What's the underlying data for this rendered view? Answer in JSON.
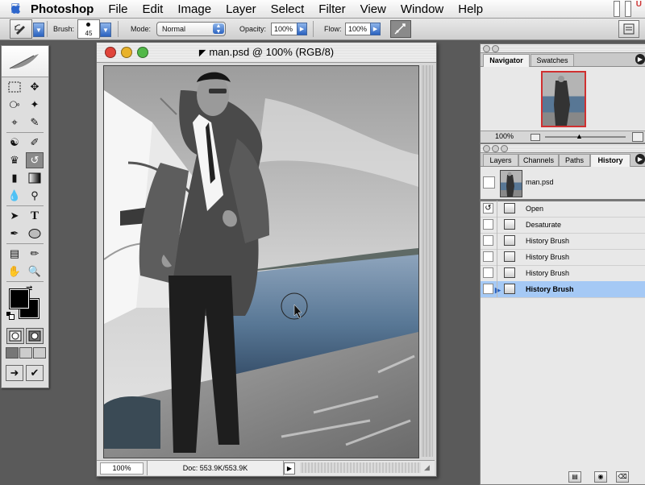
{
  "menubar": {
    "app_name": "Photoshop",
    "items": [
      "File",
      "Edit",
      "Image",
      "Layer",
      "Select",
      "Filter",
      "View",
      "Window",
      "Help"
    ],
    "apple_icon": "apple-logo",
    "status_letter": "U"
  },
  "options_bar": {
    "brush_label": "Brush:",
    "brush_size": "45",
    "mode_label": "Mode:",
    "mode_value": "Normal",
    "opacity_label": "Opacity:",
    "opacity_value": "100%",
    "flow_label": "Flow:",
    "flow_value": "100%"
  },
  "document": {
    "title": "man.psd @ 100% (RGB/8)",
    "zoom": "100%",
    "doc_size": "Doc: 553.9K/553.9K"
  },
  "navigator_panel": {
    "tabs": [
      "Navigator",
      "Swatches"
    ],
    "active_tab": "Navigator",
    "zoom": "100%"
  },
  "layers_panel": {
    "tabs": [
      "Layers",
      "Channels",
      "Paths",
      "History"
    ],
    "active_tab": "History",
    "snapshot_label": "man.psd",
    "history_states": [
      {
        "label": "Open",
        "selected": false
      },
      {
        "label": "Desaturate",
        "selected": false
      },
      {
        "label": "History Brush",
        "selected": false
      },
      {
        "label": "History Brush",
        "selected": false
      },
      {
        "label": "History Brush",
        "selected": false
      },
      {
        "label": "History Brush",
        "selected": true
      }
    ]
  },
  "colors": {
    "selection_blue": "#a5c9f5",
    "close_red": "#e0443a",
    "minimize_yellow": "#e8b22a",
    "zoom_green": "#52b848",
    "foreground": "#000000",
    "background": "#000000"
  }
}
